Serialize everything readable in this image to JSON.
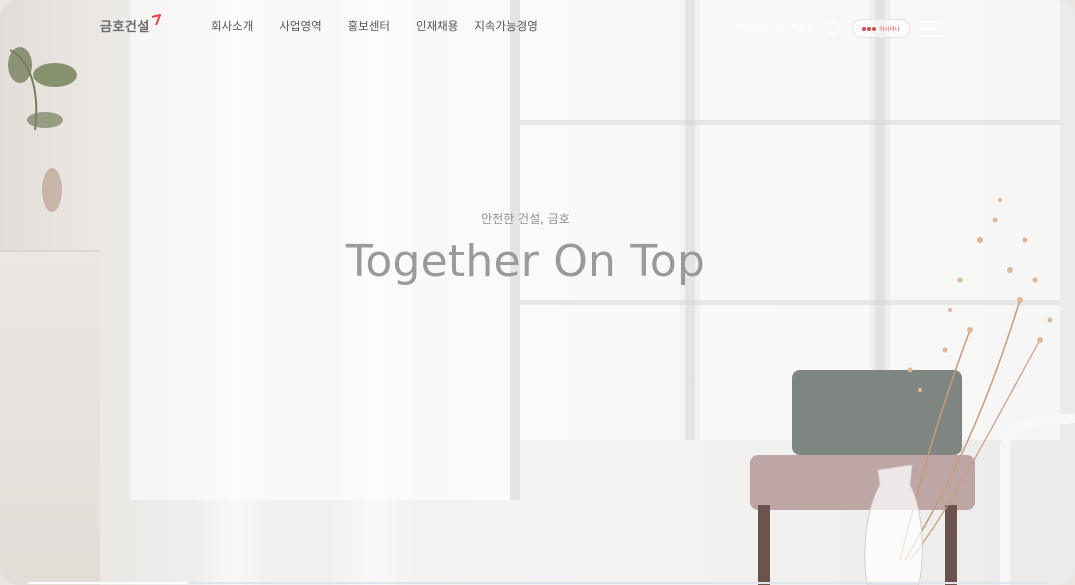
{
  "header": {
    "logo": {
      "text": "금호건설",
      "mark_color": "#e8434b"
    },
    "nav": [
      {
        "label": "회사소개"
      },
      {
        "label": "사업영역"
      },
      {
        "label": "홍보센터"
      },
      {
        "label": "인재채용"
      },
      {
        "label": "지속가능경영"
      }
    ],
    "utility": {
      "channel": "Channel",
      "separator": "|",
      "search": "고객센터",
      "family_button": "아시아나",
      "globe_icon": "globe-icon",
      "menu_icon": "hamburger-menu-icon"
    }
  },
  "hero": {
    "subtitle": "안전한 건설, 금호",
    "title": "Together On Top"
  },
  "colors": {
    "accent": "#e8434b",
    "title_gray": "#9a9a9a"
  }
}
